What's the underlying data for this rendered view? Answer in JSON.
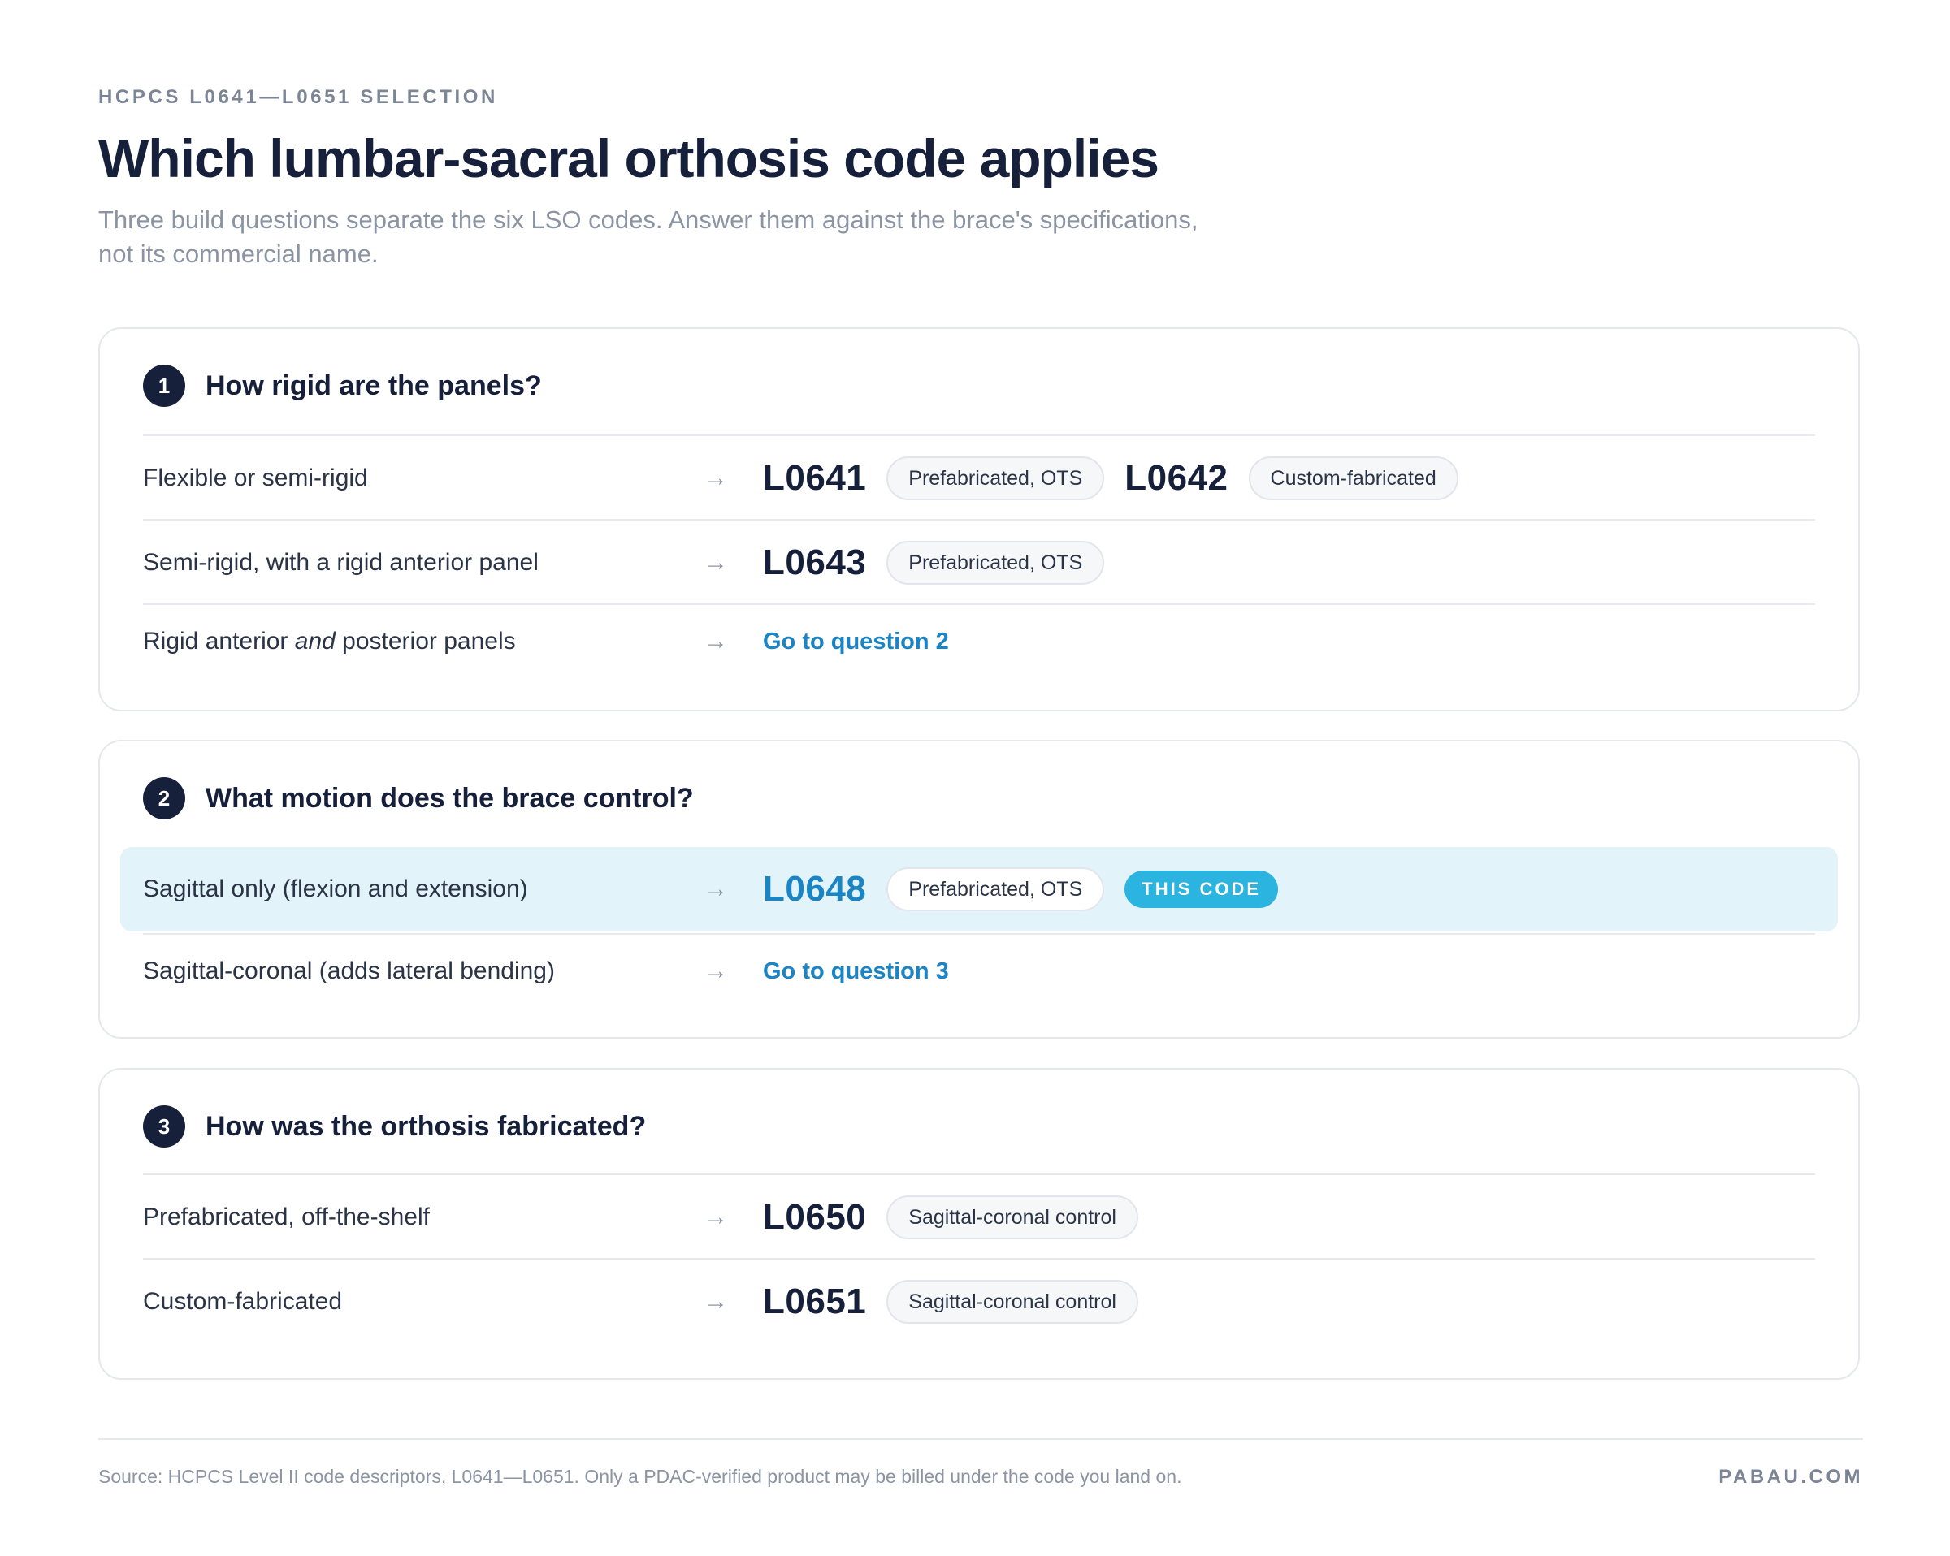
{
  "header": {
    "eyebrow": "HCPCS L0641—L0651 SELECTION",
    "title": "Which lumbar-sacral orthosis code applies",
    "subtitle": "Three build questions separate the six LSO codes. Answer them against the brace's specifications, not its commercial name."
  },
  "questions": [
    {
      "number": "1",
      "text": "How rigid are the panels?",
      "rows": [
        {
          "condition": "Flexible or semi-rigid",
          "arrow": "→",
          "code1": "L0641",
          "tag1": "Prefabricated, OTS",
          "code2": "L0642",
          "tag2": "Custom-fabricated"
        },
        {
          "condition": "Semi-rigid, with a rigid anterior panel",
          "arrow": "→",
          "code1": "L0643",
          "tag1": "Prefabricated, OTS"
        },
        {
          "condition_pre": "Rigid anterior ",
          "condition_em": "and",
          "condition_post": " posterior panels",
          "arrow": "→",
          "link": "Go to question 2"
        }
      ]
    },
    {
      "number": "2",
      "text": "What motion does the brace control?",
      "rows": [
        {
          "condition": "Sagittal only (flexion and extension)",
          "arrow": "→",
          "code1": "L0648",
          "tag1": "Prefabricated, OTS",
          "badge": "THIS CODE",
          "highlighted": true
        },
        {
          "condition": "Sagittal-coronal (adds lateral bending)",
          "arrow": "→",
          "link": "Go to question 3"
        }
      ]
    },
    {
      "number": "3",
      "text": "How was the orthosis fabricated?",
      "rows": [
        {
          "condition": "Prefabricated, off-the-shelf",
          "arrow": "→",
          "code1": "L0650",
          "tag1": "Sagittal-coronal control"
        },
        {
          "condition": "Custom-fabricated",
          "arrow": "→",
          "code1": "L0651",
          "tag1": "Sagittal-coronal control"
        }
      ]
    }
  ],
  "footer": {
    "source": "Source: HCPCS Level II code descriptors, L0641—L0651. Only a PDAC-verified product may be billed under the code you land on.",
    "brand": "PABAU.COM"
  },
  "colors": {
    "navy": "#16203a",
    "accent_blue": "#1a84c4",
    "highlight_bg": "#e2f4fa",
    "badge_bg": "#2bb4df"
  }
}
